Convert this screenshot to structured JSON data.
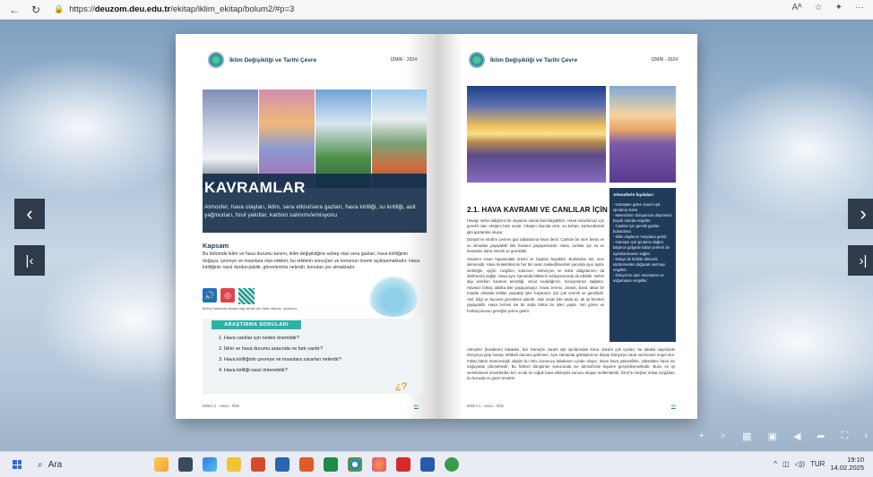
{
  "browser": {
    "url_prefix": "https://",
    "url_host": "deuzom.deu.edu.tr",
    "url_path": "/ekitap/iklim_ekitap/bolum2/#p=3",
    "reader_icon": "Aᴬ",
    "fav_icon": "☆",
    "collections_icon": "✦",
    "more_icon": "···"
  },
  "viewer": {
    "prev_icon": "‹",
    "first_icon": "|‹",
    "next_icon": "›",
    "last_icon": "›|",
    "toolbar_icons": [
      "+",
      "⌕",
      "▦",
      "▣",
      "◀",
      "➦",
      "⛶",
      "›"
    ]
  },
  "left_page": {
    "header_title": "İklim Değişikliği ve Tarihi Çevre",
    "header_date": "İZMİR - 2024",
    "hero_title": "KAVRAMLAR",
    "hero_subtitle": "Atmosfer, hava olayları, iklim, sera etkisi/sera gazları, hava kirliliği, su kirliliği, asit yağmurları, fosil yakıtlar, karbon salınımı/emisyonu",
    "kapsam_title": "Kapsam",
    "kapsam_text": "Bu bölümde iklim ve hava durumu tanımı, iklim değişikliğine sebep olan sera gazları, hava kirliliğinin doğaya, çevreye ve insanlara olan etkileri, bu etkilerin sonuçları ve konunun önemi açıklanmaktadır. Hava kirliliğinin nasıl durdurulabilir, görevlerimiz nelerdir, konuları yer almaktadır.",
    "media_note": "Bölüm hakkında detaylı bilgi almak için üstte tıklanız, okutunuz",
    "questions_heading": "ARAŞTIRMA SORULARI",
    "questions": [
      "1.  Hava canlılar için neden önemlidir?",
      "2.  İklim ve hava durumu arasında ne fark vardır?",
      "3.  Hava kirliliğinin çevreye ve insanlara zararları nelerdir?",
      "4.  Hava kirliliği nasıl önlenebilir?"
    ],
    "question_mark": "¿?",
    "footer_left": "Bölüm 2 - Hava - İklim",
    "footer_page": "02"
  },
  "right_page": {
    "header_title": "İklim Değişikliği ve Tarihi Çevre",
    "header_date": "İZMİR - 2024",
    "section_title": "2.1. HAVA KAVRAMI VE CANLILAR İÇİN ÖNEMİ",
    "paragraphs": [
      "Havayı nefes aldığımız bir okyanus olarak tanımlayabiliriz. Hava vücudumuz için gerekli olan oksijeni bize sunar. Oksijen dışında azot, su buharı, karbondioksit gibi gazlardan oluşur.",
      "Dünya'nın etrafını çeviren gaz tabakasına hava denir. Canlılar bir süre besin ve su olmadan yaşayabilir bile havasız yaşayamazlar. Hava, canlılar için su ve besinden daha önemli ve gereklidir.",
      "Havanın insan hayatındaki önemi ve faydası büyüktür. Bunlardan biri, sesı iletmesidir. Hava moleküllerinin her biri sesin nakledilmesinin yanında ayın aydın elektriğin, ışığın, rüzgârın, kokunun, televizyon ve telsiz dalgalarının da iletilmesini sağlar. Hava aynı zamanda bitkilerin tozlaşmasında da etkilidir. Nefes alıp verirken havanın temizliği, vücut sıcaklığımız, konuşmamız sağlanır. Havasız birkaç dakika bile yaşayamayız. Hava zerresi, zaman, basit, aktar bir madde olmakla birlikte yaşadığı işler hayatımız için çok önemli ve gereklidir. Akıl, bilgi ve becerisi gerektiren işlerdir. Akılı insan bile anda işi, ak işi bereket yaşayabilir. Hava zerresi ise bir anda bütün bu işleri yapar. Yeri görev ve fonksiyonunun gereğini yerine getirir."
    ],
    "paragraph_wide": "Atmosfer (havaküre) tabakası, bizi Güneş'in zararlı ışık ışınlarından korur. Zararlı ışık ışınları, bu tabaka sayesinde Dünya'ya girip havayı tehlikeli duruma getirmez. Aynı zamanda göktaşlarının düşüp Dünya'ya zarar vermesine engel olur. Fakat bütün meteorolojik olaylar bu örtü, korunucu tabakanın içinde oluşur. İnsan hava yükseklikte, yüksekten hava ise soğuyarak çökmektedir. Bu fiziksel döngünün sonucunda ise atmosferde taşınım gerçekleşmektedir. Bunu en iyi verilebilecek örneklerden biri, sıcak ve soğuk hava etkileşimi sonucu oluşan meltemlerdir. İzmir'in meşhur imbat rüzgârları bu konuda en güzel örnektir.",
    "sidebar_title": "Atmosferin faydaları:",
    "sidebar_items": [
      "- Güneşten gelen zararlı ışık ışınlarını süzer.",
      "- Meteorların dünyamıza düşmesini büyük oranda engeller.",
      "- Canlılar için gerekli gazları bulundurur.",
      "- İklim olaylarını meydana getirir.",
      "- Güneşin ışık ışınlarını dağıtır. Böylece gölgede kalan yerlerin de aydınlanmasını sağlar.",
      "- Dünya ile birlikte dönerek sürtünmeden doğacak ısınmayı engeller.",
      "- Dünya'nın aşırı ısınmasını ve soğumasını engeller."
    ],
    "footer_left": "Bölüm 2 - Hava - İklim",
    "footer_page": "03"
  },
  "taskbar": {
    "search_label": "Ara",
    "lang": "TUR",
    "time": "19:10",
    "date": "14.02.2025"
  },
  "colors": {
    "hero_band": "#122c48",
    "accent": "#29b3a3",
    "sidebar_box": "#1f3b5c",
    "taskbar": "#e9edf3"
  }
}
